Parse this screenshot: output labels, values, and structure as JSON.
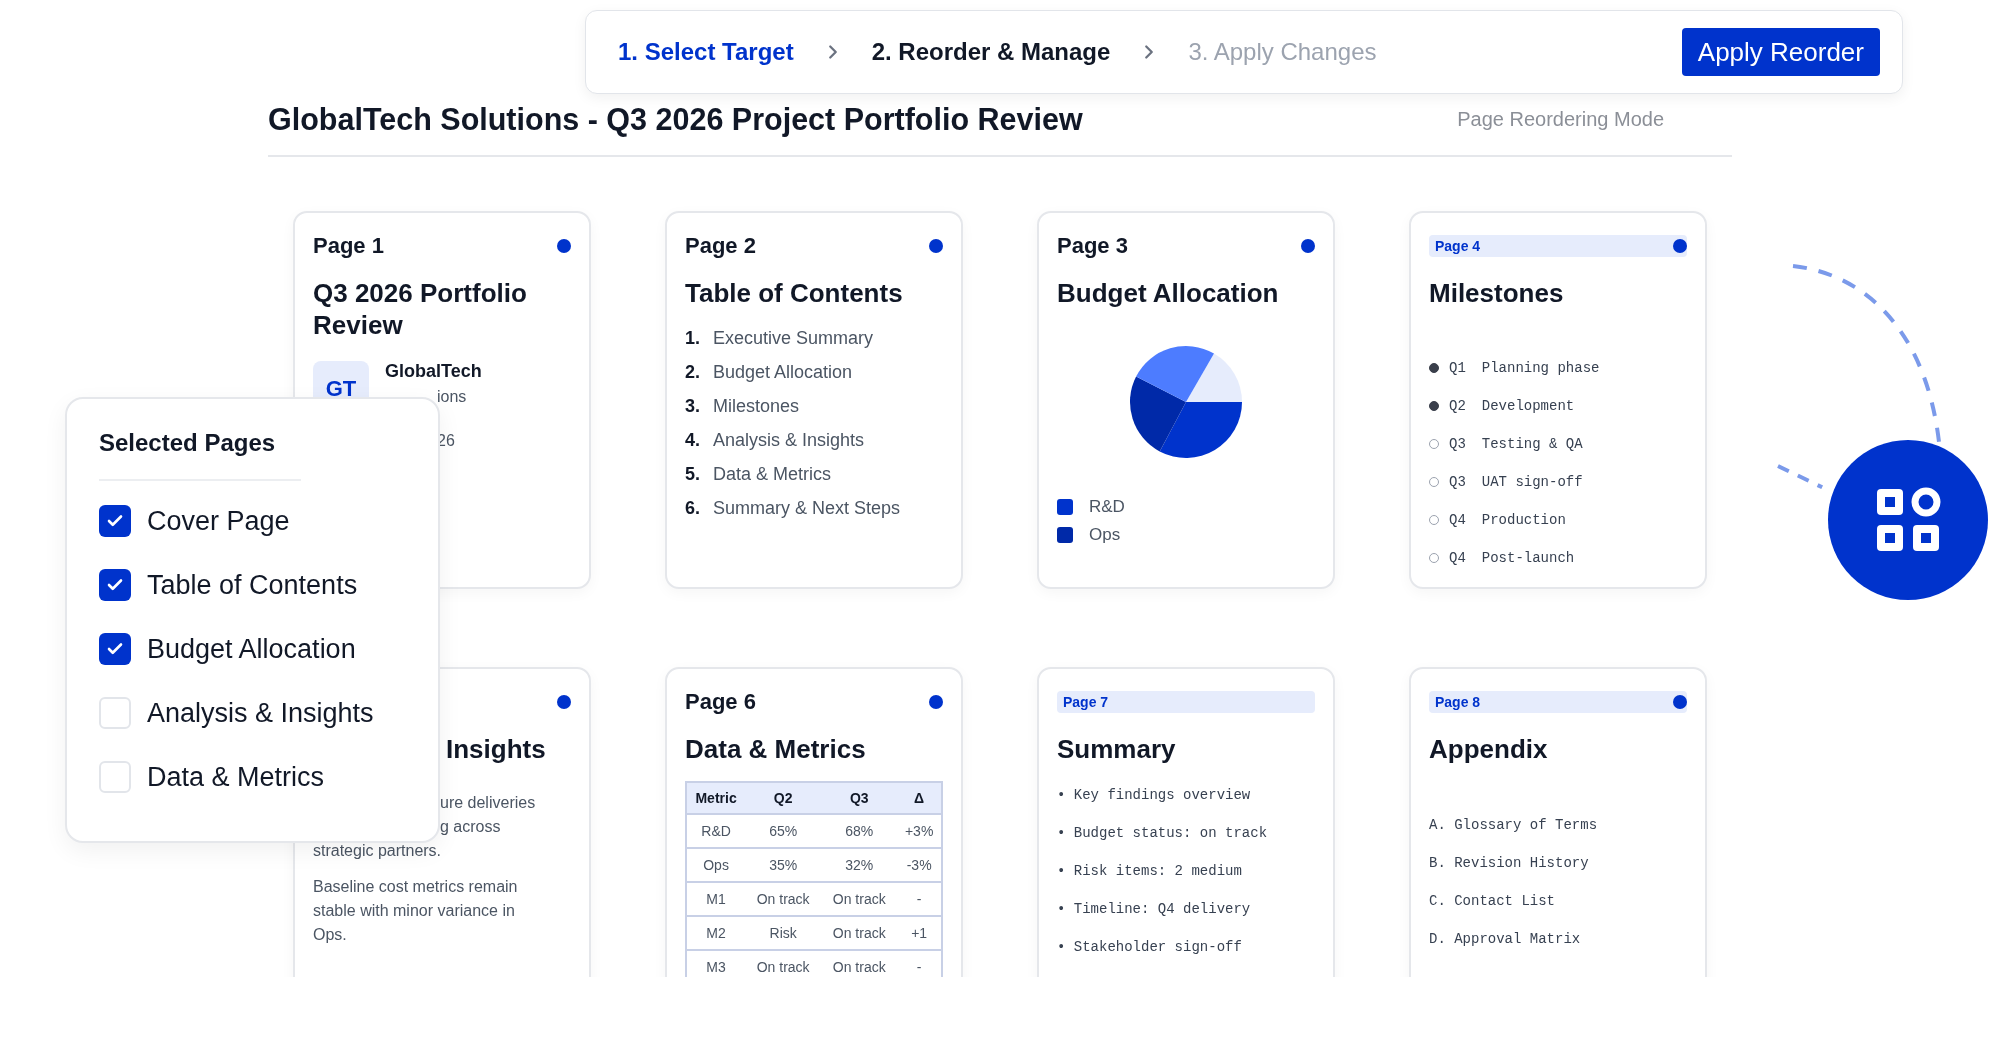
{
  "stepper": {
    "steps": [
      {
        "label": "1. Select Target",
        "selected": true,
        "disabled": false
      },
      {
        "label": "2. Reorder & Manage",
        "selected": false,
        "disabled": false
      },
      {
        "label": "3. Apply Changes",
        "selected": false,
        "disabled": true
      }
    ],
    "action": "Apply Reorder"
  },
  "header": {
    "title": "GlobalTech Solutions - Q3 2026 Project Portfolio Review",
    "mode": "Page Reordering Mode"
  },
  "pages": [
    {
      "kind": "cover",
      "label": "Page 1",
      "highlighted": false,
      "dot": true,
      "title": "Q3 2026 Portfolio Review",
      "avatar": "GT",
      "org": "GlobalTech",
      "org_sub": "ions",
      "date": "26"
    },
    {
      "kind": "toc",
      "label": "Page 2",
      "highlighted": false,
      "dot": true,
      "title": "Table of Contents",
      "items": [
        {
          "number": "1.",
          "text": "Executive Summary"
        },
        {
          "number": "2.",
          "text": "Budget Allocation"
        },
        {
          "number": "3.",
          "text": "Milestones"
        },
        {
          "number": "4.",
          "text": "Analysis & Insights"
        },
        {
          "number": "5.",
          "text": "Data & Metrics"
        },
        {
          "number": "6.",
          "text": "Summary & Next Steps"
        }
      ]
    },
    {
      "kind": "chart",
      "label": "Page 3",
      "highlighted": false,
      "dot": true,
      "title": "Budget Allocation",
      "legend": [
        {
          "label": "R&D",
          "color": "#0033cc"
        },
        {
          "label": "Ops",
          "color": "#0029a8"
        }
      ]
    },
    {
      "kind": "milestones",
      "label": "Page 4",
      "highlighted": true,
      "dot": true,
      "title": "Milestones",
      "items": [
        {
          "quarter": "Q1",
          "text": "Planning phase",
          "done": true
        },
        {
          "quarter": "Q2",
          "text": "Development",
          "done": true
        },
        {
          "quarter": "Q3",
          "text": "Testing & QA",
          "done": false
        },
        {
          "quarter": "Q3",
          "text": "UAT sign-off",
          "done": false
        },
        {
          "quarter": "Q4",
          "text": "Production",
          "done": false
        },
        {
          "quarter": "Q4",
          "text": "Post-launch",
          "done": false
        }
      ]
    },
    {
      "kind": "text",
      "dot": true,
      "title": "Insights",
      "fragments": [
        "ure deliveries",
        "g across"
      ],
      "paragraphs": [
        "strategic partners.",
        "Baseline cost metrics remain stable with minor variance in Ops."
      ]
    },
    {
      "kind": "table",
      "label": "Page 6",
      "highlighted": false,
      "dot": true,
      "title": "Data & Metrics",
      "columns": [
        "Metric",
        "Q2",
        "Q3",
        "Δ"
      ],
      "rows": [
        [
          "R&D",
          "65%",
          "68%",
          "+3%"
        ],
        [
          "Ops",
          "35%",
          "32%",
          "-3%"
        ],
        [
          "M1",
          "On track",
          "On track",
          "-"
        ],
        [
          "M2",
          "Risk",
          "On track",
          "+1"
        ],
        [
          "M3",
          "On track",
          "On track",
          "-"
        ]
      ]
    },
    {
      "kind": "bullets",
      "label": "Page 7",
      "highlighted": true,
      "dot": false,
      "title": "Summary",
      "items": [
        "• Key findings overview",
        "• Budget status: on track",
        "• Risk items: 2 medium",
        "• Timeline: Q4 delivery",
        "• Stakeholder sign-off"
      ]
    },
    {
      "kind": "appendix",
      "label": "Page 8",
      "highlighted": true,
      "dot": true,
      "title": "Appendix",
      "items": [
        "A. Glossary of Terms",
        "B. Revision History",
        "C. Contact List",
        "D. Approval Matrix"
      ]
    }
  ],
  "selected_pages": {
    "title": "Selected Pages",
    "items": [
      {
        "label": "Cover Page",
        "checked": true
      },
      {
        "label": "Table of Contents",
        "checked": true
      },
      {
        "label": "Budget Allocation",
        "checked": true
      },
      {
        "label": "Analysis & Insights",
        "checked": false
      },
      {
        "label": "Data & Metrics",
        "checked": false
      }
    ]
  }
}
